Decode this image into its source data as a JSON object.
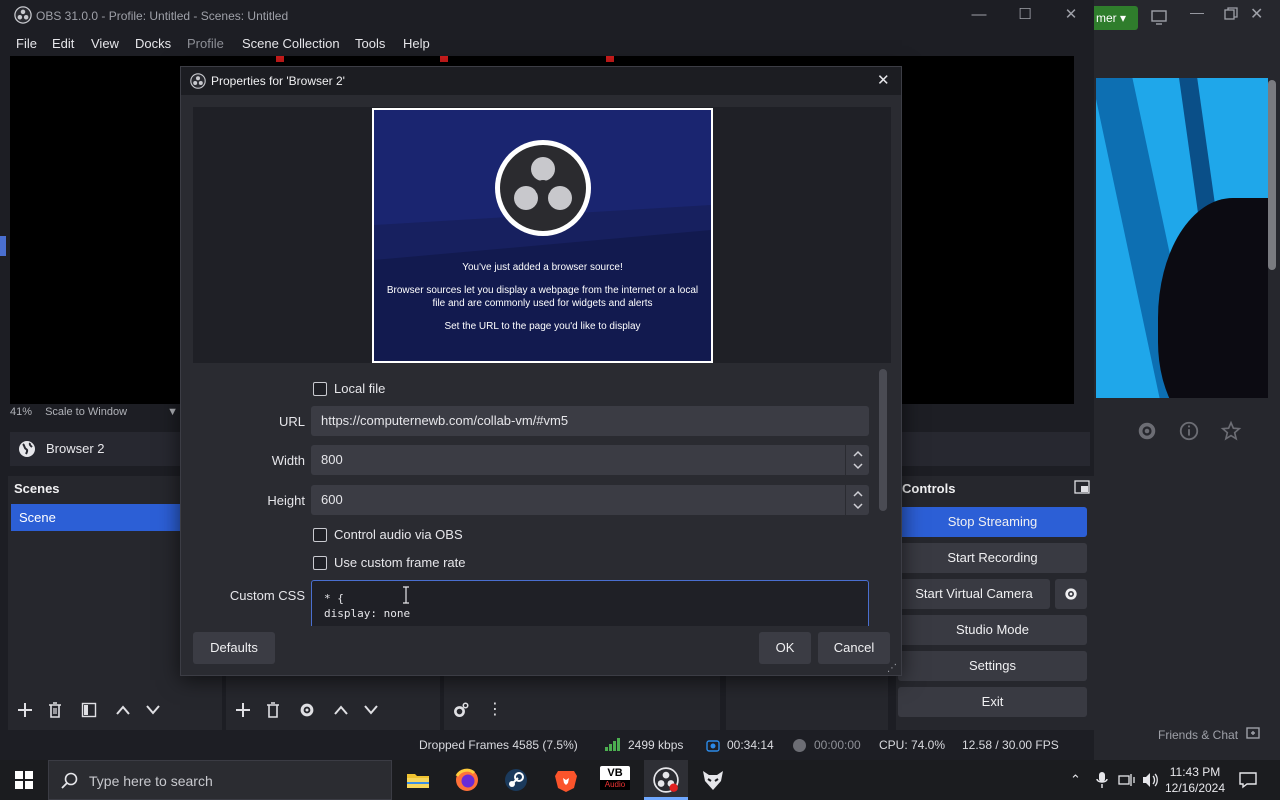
{
  "window": {
    "title": "OBS 31.0.0 - Profile: Untitled - Scenes: Untitled"
  },
  "menu": [
    "File",
    "Edit",
    "View",
    "Docks",
    "Profile",
    "Scene Collection",
    "Tools",
    "Help"
  ],
  "preview": {
    "zoom": "41%",
    "scale_mode": "Scale to Window"
  },
  "source_bar": {
    "selected_source": "Browser 2"
  },
  "scenes_dock": {
    "title": "Scenes",
    "items": [
      "Scene"
    ]
  },
  "controls_dock": {
    "title": "Controls",
    "buttons": {
      "stop_streaming": "Stop Streaming",
      "start_recording": "Start Recording",
      "start_virtual_camera": "Start Virtual Camera",
      "studio_mode": "Studio Mode",
      "settings": "Settings",
      "exit": "Exit"
    }
  },
  "status_bar": {
    "dropped_frames": "Dropped Frames 4585 (7.5%)",
    "bitrate": "2499 kbps",
    "stream_time": "00:34:14",
    "record_time": "00:00:00",
    "cpu": "CPU: 74.0%",
    "fps": "12.58 / 30.00 FPS"
  },
  "dialog": {
    "title": "Properties for 'Browser 2'",
    "browser_preview": {
      "heading": "You've just added a browser source!",
      "body": "Browser sources let you display a webpage from the internet or a local file and are commonly used for widgets and alerts",
      "hint": "Set the URL to the page you'd like to display"
    },
    "local_file_label": "Local file",
    "url_label": "URL",
    "url_value": "https://computernewb.com/collab-vm/#vm5",
    "width_label": "Width",
    "width_value": "800",
    "height_label": "Height",
    "height_value": "600",
    "control_audio_label": "Control audio via OBS",
    "custom_fps_label": "Use custom frame rate",
    "custom_css_label": "Custom CSS",
    "custom_css_line1": "* {",
    "custom_css_line2": "display: none",
    "defaults_button": "Defaults",
    "ok_button": "OK",
    "cancel_button": "Cancel"
  },
  "background_app": {
    "pill_label": "mer",
    "friends_chat": "Friends & Chat"
  },
  "taskbar": {
    "search_placeholder": "Type here to search",
    "vb_label": "VB",
    "vb_sub": "Audio",
    "time": "11:43 PM",
    "date": "12/16/2024"
  },
  "colors": {
    "accent": "#2c5fd6",
    "dialog_bg": "#2a2b31",
    "window_bg": "#1d1e24"
  }
}
